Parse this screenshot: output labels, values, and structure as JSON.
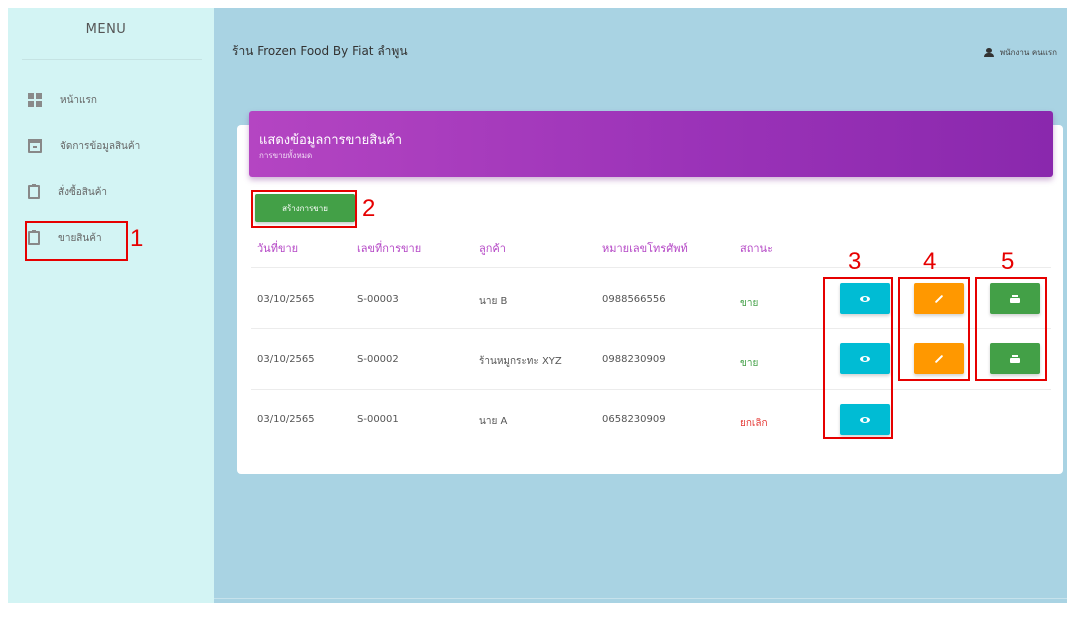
{
  "sidebar": {
    "title": "MENU",
    "items": [
      {
        "label": "หน้าแรก",
        "icon": "dashboard-icon"
      },
      {
        "label": "จัดการข้อมูลสินค้า",
        "icon": "archive-icon"
      },
      {
        "label": "สั่งซื้อสินค้า",
        "icon": "clipboard-icon"
      },
      {
        "label": "ขายสินค้า",
        "icon": "clipboard-icon"
      }
    ]
  },
  "header": {
    "title": "ร้าน Frozen Food By Fiat ลำพูน",
    "user": "พนักงาน คนแรก"
  },
  "card": {
    "title": "แสดงข้อมูลการขายสินค้า",
    "subtitle": "การขายทั้งหมด",
    "create_label": "สร้างการขาย"
  },
  "table": {
    "headers": [
      "วันที่ขาย",
      "เลขที่การขาย",
      "ลูกค้า",
      "หมายเลขโทรศัพท์",
      "สถานะ"
    ],
    "rows": [
      {
        "date": "03/10/2565",
        "sale_no": "S-00003",
        "customer": "นาย B",
        "phone": "0988566556",
        "status": "ขาย"
      },
      {
        "date": "03/10/2565",
        "sale_no": "S-00002",
        "customer": "ร้านหมูกระทะ XYZ",
        "phone": "0988230909",
        "status": "ขาย"
      },
      {
        "date": "03/10/2565",
        "sale_no": "S-00001",
        "customer": "นาย A",
        "phone": "0658230909",
        "status": "ยกเลิก"
      }
    ]
  },
  "annotations": [
    "1",
    "2",
    "3",
    "4",
    "5"
  ],
  "colors": {
    "sidebar_bg": "#d3f4f4",
    "main_bg": "#a9d3e3",
    "header_purple": "#9b33b8",
    "view_btn": "#00bcd4",
    "edit_btn": "#ff9800",
    "print_btn": "#43a047",
    "status_sell": "#43a047",
    "status_cancel": "#e53935",
    "annotation_red": "#e60000"
  }
}
